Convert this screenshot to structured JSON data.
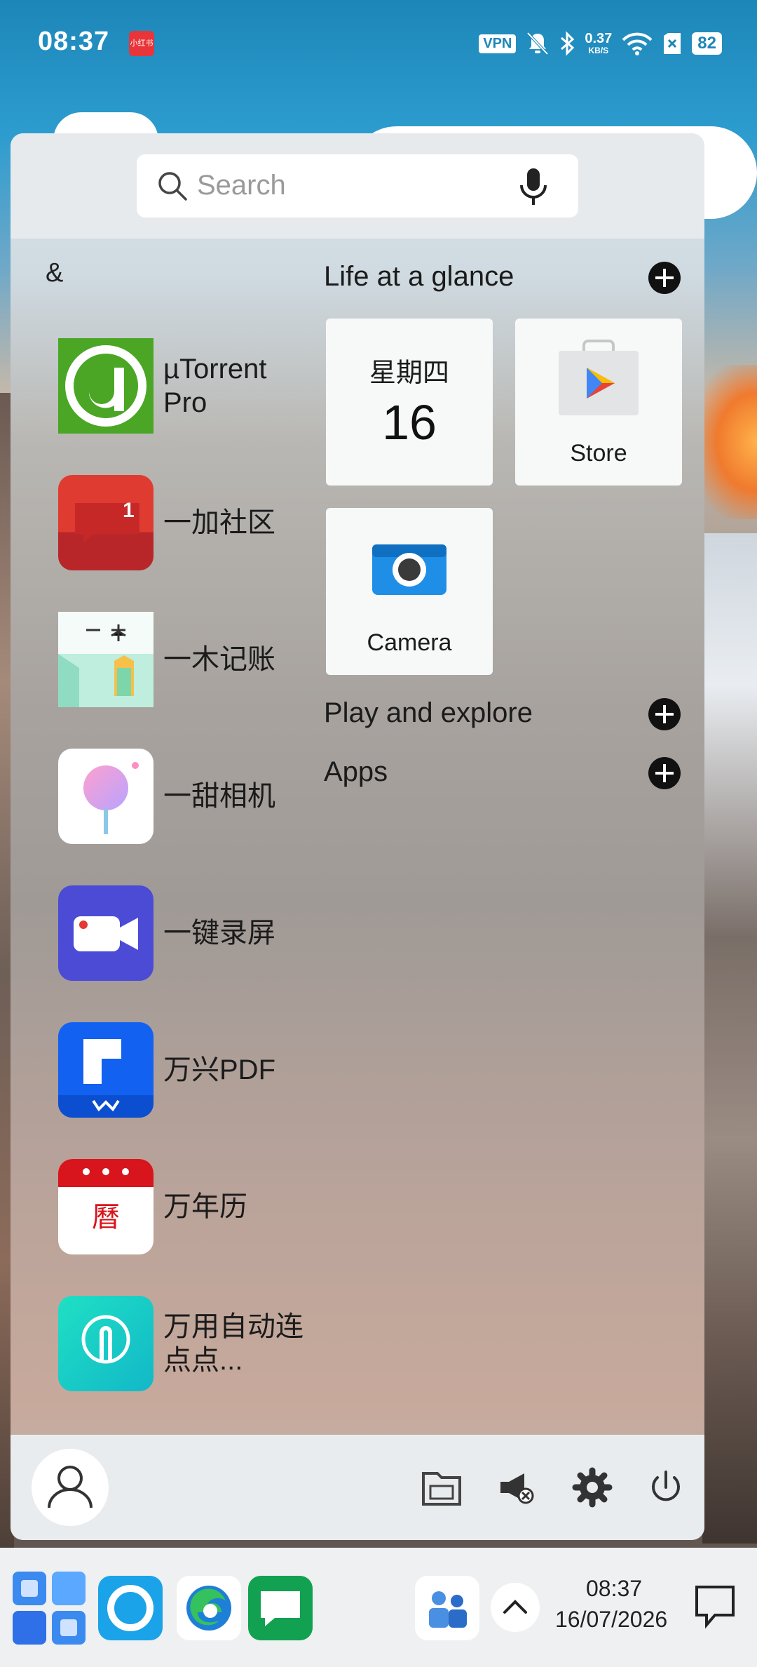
{
  "status_bar": {
    "time": "08:37",
    "app_badge": "小红书",
    "vpn": "VPN",
    "speed_value": "0.37",
    "speed_unit": "KB/S",
    "battery": "82"
  },
  "search": {
    "placeholder": "Search"
  },
  "app_list": {
    "section_letter": "&",
    "items": [
      {
        "label": "µTorrent Pro"
      },
      {
        "label": "一加社区",
        "badge": "1"
      },
      {
        "label": "一木记账"
      },
      {
        "label": "一甜相机"
      },
      {
        "label": "一键录屏"
      },
      {
        "label": "万兴PDF"
      },
      {
        "label": "万年历"
      },
      {
        "label": "万用自动连点点..."
      }
    ]
  },
  "life_at_a_glance": {
    "title": "Life at a glance",
    "calendar_weekday": "星期四",
    "calendar_day": "16",
    "store_label": "Store",
    "camera_label": "Camera"
  },
  "play_and_explore": {
    "title": "Play and explore"
  },
  "apps_section": {
    "title": "Apps"
  },
  "taskbar": {
    "time": "08:37",
    "date": "16/07/2026"
  },
  "colors": {
    "accent_blue": "#2f6fe8",
    "utorrent_green": "#4aa624",
    "oneplus_red": "#d32f2f",
    "wondershare_blue": "#1261f1",
    "calendar_red": "#d8141c"
  }
}
